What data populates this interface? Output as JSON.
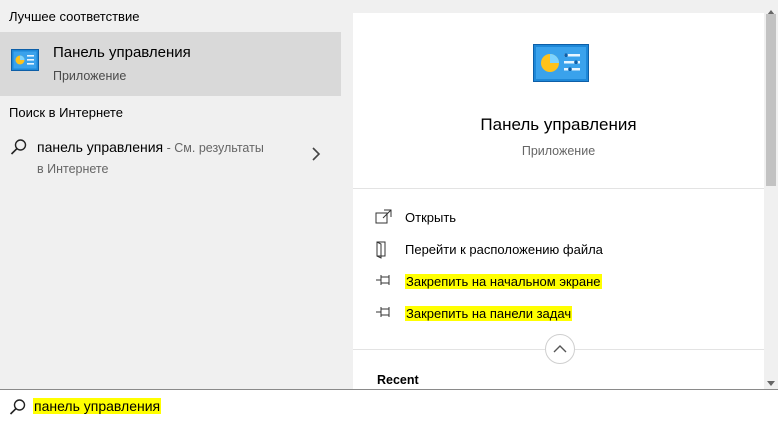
{
  "left": {
    "best_match_title": "Лучшее соответствие",
    "best_match": {
      "name": "Панель управления",
      "type": "Приложение",
      "icon": "control-panel-icon"
    },
    "web_title": "Поиск в Интернете",
    "web_result": {
      "query": "панель управления",
      "suffix": " - См. результаты",
      "line2": "в Интернете",
      "icon": "search-icon"
    }
  },
  "preview": {
    "icon": "control-panel-icon",
    "title": "Панель управления",
    "type": "Приложение",
    "actions": [
      {
        "label": "Открыть",
        "icon": "open-icon",
        "highlighted": false
      },
      {
        "label": "Перейти к расположению файла",
        "icon": "file-location-icon",
        "highlighted": false
      },
      {
        "label": "Закрепить на начальном экране",
        "icon": "pin-icon",
        "highlighted": true
      },
      {
        "label": "Закрепить на панели задач",
        "icon": "pin-icon",
        "highlighted": true
      }
    ],
    "recent_title": "Recent"
  },
  "search": {
    "value": "панель управления",
    "icon": "search-icon"
  },
  "colors": {
    "highlight": "#ffff00",
    "selected_row": "#d9d9d9",
    "pane_bg": "#f0f0f0"
  }
}
